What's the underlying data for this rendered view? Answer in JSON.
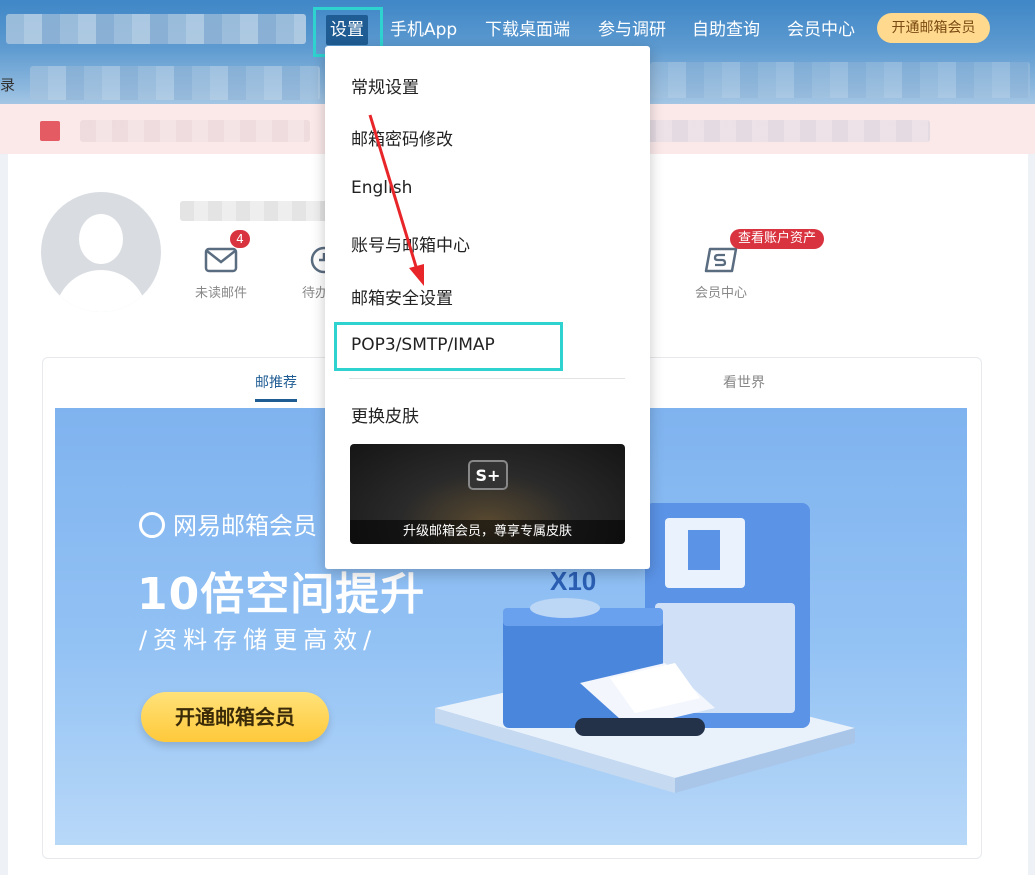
{
  "nav": {
    "items": [
      "设置",
      "手机App",
      "下载桌面端",
      "参与调研",
      "自助查询",
      "会员中心"
    ],
    "vip_button": "开通邮箱会员"
  },
  "header": {
    "login_fragment": "录"
  },
  "settings_menu": {
    "items": [
      "常规设置",
      "邮箱密码修改",
      "English",
      "账号与邮箱中心",
      "邮箱安全设置",
      "POP3/SMTP/IMAP",
      "更换皮肤"
    ],
    "skin_card_caption": "升级邮箱会员，尊享专属皮肤",
    "skin_card_logo": "S+"
  },
  "profile": {
    "quick_actions": [
      {
        "label": "未读邮件",
        "icon": "envelope-icon"
      },
      {
        "label": "待办",
        "icon": "clock-icon"
      },
      {
        "label": "会员中心",
        "icon": "member-s-icon"
      }
    ],
    "unread_badge": "4",
    "asset_badge": "查看账户资产"
  },
  "feed": {
    "tabs": [
      "邮推荐",
      "看世界"
    ],
    "active_tab": "邮推荐"
  },
  "banner": {
    "brand": "网易邮箱会员",
    "headline": "10倍空间提升",
    "subline": "/资料存储更高效/",
    "cta": "开通邮箱会员",
    "badge_text": "X10"
  },
  "colors": {
    "nav_blue": "#3f87c7",
    "active_tab": "#1f5c93",
    "highlight": "#2ed2cf",
    "arrow_red": "#e8262a",
    "badge_red": "#d9333f",
    "vip_gold": "#ffd98e"
  }
}
